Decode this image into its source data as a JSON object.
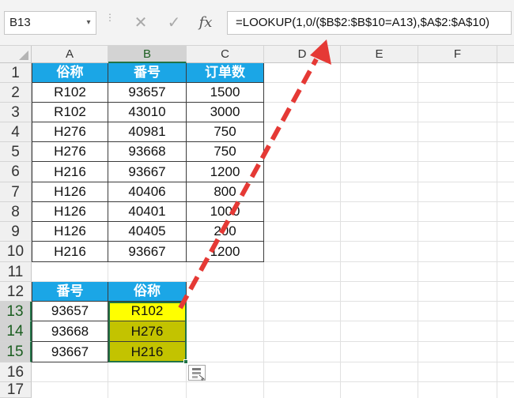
{
  "name_box": "B13",
  "formula_bar": {
    "cancel_glyph": "✕",
    "enter_glyph": "✓",
    "fx_label": "fx",
    "formula": "=LOOKUP(1,0/($B$2:$B$10=A13),$A$2:$A$10)"
  },
  "columns": [
    "A",
    "B",
    "C",
    "D",
    "E",
    "F"
  ],
  "rows": [
    "1",
    "2",
    "3",
    "4",
    "5",
    "6",
    "7",
    "8",
    "9",
    "10",
    "11",
    "12",
    "13",
    "14",
    "15",
    "16",
    "17"
  ],
  "table1": {
    "headers": [
      "俗称",
      "番号",
      "订单数"
    ],
    "rows": [
      [
        "R102",
        "93657",
        "1500"
      ],
      [
        "R102",
        "43010",
        "3000"
      ],
      [
        "H276",
        "40981",
        "750"
      ],
      [
        "H276",
        "93668",
        "750"
      ],
      [
        "H216",
        "93667",
        "1200"
      ],
      [
        "H126",
        "40406",
        "800"
      ],
      [
        "H126",
        "40401",
        "1000"
      ],
      [
        "H126",
        "40405",
        "200"
      ],
      [
        "H216",
        "93667",
        "1200"
      ]
    ]
  },
  "table2": {
    "headers": [
      "番号",
      "俗称"
    ],
    "rows": [
      [
        "93657",
        "R102"
      ],
      [
        "93668",
        "H276"
      ],
      [
        "93667",
        "H216"
      ]
    ]
  },
  "colors": {
    "header_fill": "#1ba6e6",
    "result_highlight": "#ffff00",
    "result_fill": "#c3c300",
    "selection_border": "#217346",
    "arrow": "#e53935"
  }
}
